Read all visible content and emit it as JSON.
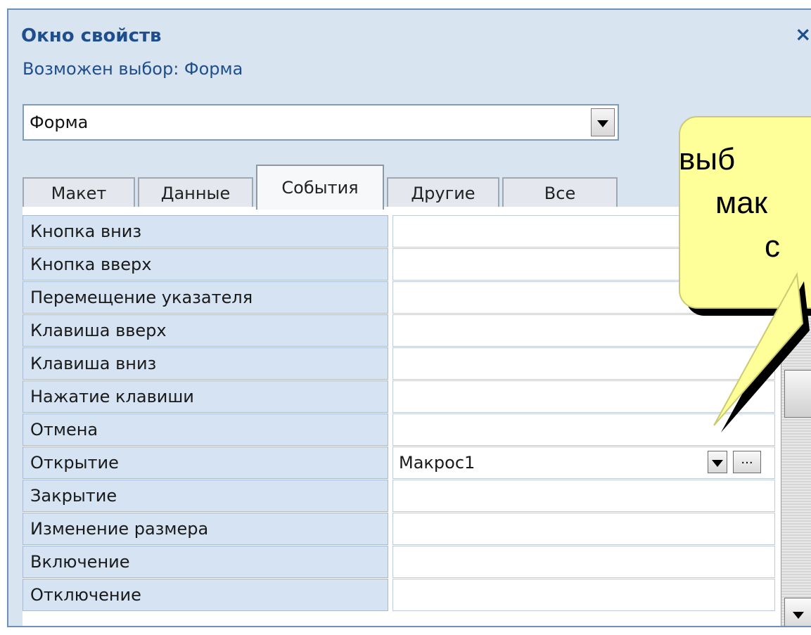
{
  "window": {
    "title": "Окно свойств",
    "close_label": "×",
    "selection_text": "Возможен выбор: Форма",
    "combo_value": "Форма"
  },
  "tabs": [
    {
      "label": "Макет"
    },
    {
      "label": "Данные"
    },
    {
      "label": "События"
    },
    {
      "label": "Другие"
    },
    {
      "label": "Все"
    }
  ],
  "rows": [
    {
      "label": "Кнопка вниз",
      "value": ""
    },
    {
      "label": "Кнопка вверх",
      "value": ""
    },
    {
      "label": "Перемещение указателя",
      "value": ""
    },
    {
      "label": "Клавиша вверх",
      "value": ""
    },
    {
      "label": "Клавиша вниз",
      "value": ""
    },
    {
      "label": "Нажатие клавиши",
      "value": ""
    },
    {
      "label": "Отмена",
      "value": ""
    },
    {
      "label": "Открытие",
      "value": "Макрос1"
    },
    {
      "label": "Закрытие",
      "value": ""
    },
    {
      "label": "Изменение размера",
      "value": ""
    },
    {
      "label": "Включение",
      "value": ""
    },
    {
      "label": "Отключение",
      "value": ""
    }
  ],
  "callout": {
    "line1": "выб",
    "line2": "мак",
    "line3": "с"
  },
  "buttons": {
    "dots_label": "..."
  }
}
